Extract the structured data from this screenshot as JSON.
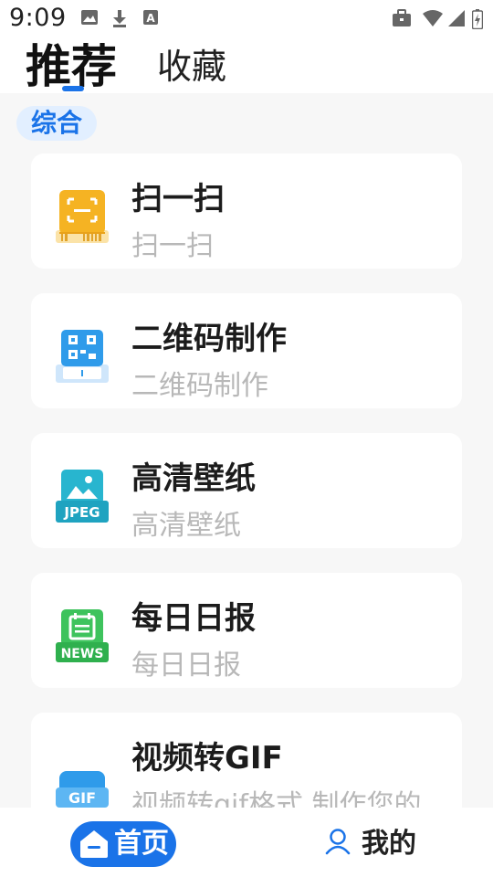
{
  "status_bar": {
    "time": "9:09",
    "left_icons": [
      "image-icon",
      "download-icon",
      "font-icon"
    ],
    "right_icons": [
      "briefcase-icon",
      "wifi-icon",
      "signal-icon",
      "battery-icon"
    ]
  },
  "tabs": [
    {
      "label": "推荐",
      "active": true
    },
    {
      "label": "收藏",
      "active": false
    }
  ],
  "section": {
    "label": "综合"
  },
  "cards": [
    {
      "title": "扫一扫",
      "subtitle": "扫一扫",
      "icon": "scan-icon"
    },
    {
      "title": "二维码制作",
      "subtitle": "二维码制作",
      "icon": "qrcode-icon"
    },
    {
      "title": "高清壁纸",
      "subtitle": "高清壁纸",
      "icon": "jpeg-image-icon"
    },
    {
      "title": "每日日报",
      "subtitle": "每日日报",
      "icon": "news-icon"
    },
    {
      "title": "视频转GIF",
      "subtitle": "视频转gif格式,制作您的",
      "icon": "gif-icon"
    }
  ],
  "bottom_nav": [
    {
      "label": "首页",
      "icon": "home-icon",
      "active": true
    },
    {
      "label": "我的",
      "icon": "user-icon",
      "active": false
    }
  ],
  "colors": {
    "accent": "#1a73e8",
    "chip_bg": "#e2efff",
    "content_bg": "#f7f7f7"
  }
}
